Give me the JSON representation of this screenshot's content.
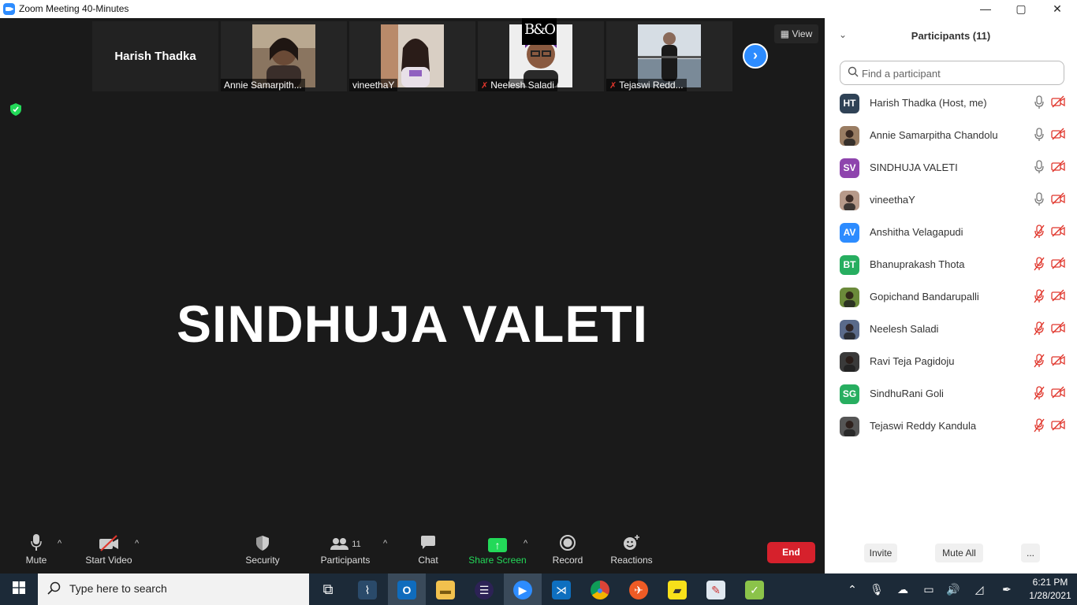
{
  "window": {
    "title": "Zoom Meeting 40-Minutes",
    "min": "—",
    "max": "▢",
    "close": "✕"
  },
  "overlay": {
    "logo": "B&O"
  },
  "thumbs": [
    {
      "name": "Harish Thadka"
    },
    {
      "name": "Annie Samarpith..."
    },
    {
      "name": "vineethaY"
    },
    {
      "name": "Neelesh Saladi"
    },
    {
      "name": "Tejaswi Redd..."
    }
  ],
  "next_glyph": "›",
  "view_btn": {
    "icon": "▦",
    "label": "View"
  },
  "active_speaker": "SINDHUJA VALETI",
  "toolbar": {
    "mute": "Mute",
    "start_video": "Start Video",
    "security": "Security",
    "participants": "Participants",
    "participants_count": "11",
    "chat": "Chat",
    "share_screen": "Share Screen",
    "record": "Record",
    "reactions": "Reactions",
    "end": "End",
    "caret": "^"
  },
  "panel": {
    "chevron": "⌄",
    "title": "Participants (11)",
    "search_placeholder": "Find a participant",
    "participants": [
      {
        "initials": "HT",
        "name": "Harish Thadka (Host, me)",
        "color": "#2f4256"
      },
      {
        "initials": "",
        "name": "Annie Samarpitha Chandolu",
        "color": "#9a7d63"
      },
      {
        "initials": "SV",
        "name": "SINDHUJA VALETI",
        "color": "#8e44ad"
      },
      {
        "initials": "",
        "name": "vineethaY",
        "color": "#b79a8a"
      },
      {
        "initials": "AV",
        "name": "Anshitha Velagapudi",
        "color": "#2d8cff"
      },
      {
        "initials": "BT",
        "name": "Bhanuprakash Thota",
        "color": "#27ae60"
      },
      {
        "initials": "",
        "name": "Gopichand Bandarupalli",
        "color": "#6b8a3a"
      },
      {
        "initials": "",
        "name": "Neelesh Saladi",
        "color": "#5a6a8a"
      },
      {
        "initials": "",
        "name": "Ravi Teja Pagidoju",
        "color": "#3a3a3a"
      },
      {
        "initials": "SG",
        "name": "SindhuRani Goli",
        "color": "#27ae60"
      },
      {
        "initials": "",
        "name": "Tejaswi Reddy Kandula",
        "color": "#555555"
      }
    ],
    "invite": "Invite",
    "mute_all": "Mute All",
    "more": "..."
  },
  "taskbar": {
    "search_placeholder": "Type here to search",
    "time": "6:21 PM",
    "date": "1/28/2021"
  }
}
